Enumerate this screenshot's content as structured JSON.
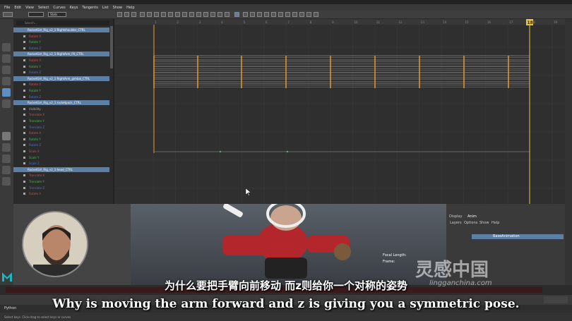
{
  "menu": [
    "File",
    "Edit",
    "View",
    "Select",
    "Curves",
    "Keys",
    "Tangents",
    "List",
    "Show",
    "Help"
  ],
  "outliner": {
    "search_placeholder": "Search...",
    "rows": [
      {
        "label": "RocketGirl_Rig_v2_1:Rightshoulder_CTRL",
        "selected": true
      },
      {
        "label": "Rotate X",
        "selected": false
      },
      {
        "label": "Rotate Y",
        "selected": false
      },
      {
        "label": "Rotate Z",
        "selected": false
      },
      {
        "label": "RocketGirl_Rig_v2_1:RightArm_FK_CTRL",
        "selected": true
      },
      {
        "label": "Rotate X",
        "selected": false
      },
      {
        "label": "Rotate Y",
        "selected": false
      },
      {
        "label": "Rotate Z",
        "selected": false
      },
      {
        "label": "RocketGirl_Rig_v2_1:RightArm_gimbal_CTRL",
        "selected": true
      },
      {
        "label": "Rotate X",
        "selected": false
      },
      {
        "label": "Rotate Y",
        "selected": false
      },
      {
        "label": "Rotate Z",
        "selected": false
      },
      {
        "label": "RocketGirl_Rig_v2_1:rocketpack_CTRL",
        "selected": true
      },
      {
        "label": "Visibility",
        "selected": false
      },
      {
        "label": "Translate X",
        "selected": false
      },
      {
        "label": "Translate Y",
        "selected": false
      },
      {
        "label": "Translate Z",
        "selected": false
      },
      {
        "label": "Rotate X",
        "selected": false
      },
      {
        "label": "Rotate Y",
        "selected": false
      },
      {
        "label": "Rotate Z",
        "selected": false
      },
      {
        "label": "Scale X",
        "selected": false
      },
      {
        "label": "Scale Y",
        "selected": false
      },
      {
        "label": "Scale Z",
        "selected": false
      },
      {
        "label": "RocketGirl_Rig_v2_1:head_CTRL",
        "selected": true
      },
      {
        "label": "Translate X",
        "selected": false
      },
      {
        "label": "Translate Y",
        "selected": false
      },
      {
        "label": "Translate Z",
        "selected": false
      },
      {
        "label": "Rotate X",
        "selected": false
      }
    ]
  },
  "graph": {
    "stats_label": "Stats",
    "current_frame": "18",
    "ruler": [
      "1",
      "2",
      "3",
      "4",
      "5",
      "6",
      "7",
      "8",
      "9",
      "10",
      "11",
      "12",
      "13",
      "14",
      "15",
      "16",
      "17",
      "18",
      "19"
    ]
  },
  "channelbox": {
    "tabs": [
      "Display",
      "Anim"
    ],
    "menu": [
      "Layers",
      "Options",
      "Show",
      "Help"
    ],
    "layer": "BaseAnimation"
  },
  "viewport": {
    "focal_length_label": "Focal Length:",
    "frame_label": "Frame:"
  },
  "subtitles": {
    "cn": "为什么要把手臂向前移动 而z则给你一个对称的姿势",
    "en": "Why is moving the arm forward and z is giving you a symmetric pose."
  },
  "watermark": {
    "text": "灵感中国",
    "url": "lingganchina.com"
  },
  "cmdline": {
    "label": "Python"
  },
  "helpline": {
    "text": "Select keys. Click-drag to select keys or curves"
  },
  "colors": {
    "selected_row": "#5d7fa3",
    "key_orange": "#e39a2f",
    "curve": "#9a9a9a",
    "current_frame": "#e8c43a"
  }
}
